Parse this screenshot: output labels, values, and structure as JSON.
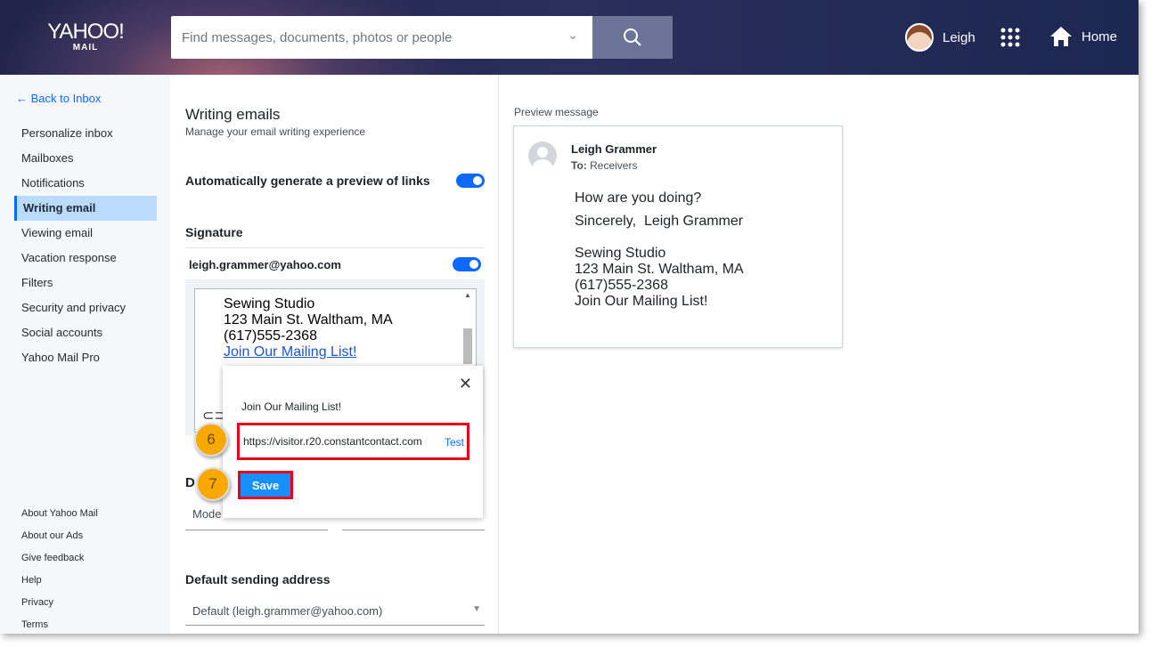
{
  "header": {
    "logo_top": "YAHOO!",
    "logo_bottom": "MAIL",
    "search_placeholder": "Find messages, documents, photos or people",
    "user": "Leigh",
    "home": "Home"
  },
  "sidebar": {
    "back": "Back to Inbox",
    "items": [
      "Personalize inbox",
      "Mailboxes",
      "Notifications",
      "Writing email",
      "Viewing email",
      "Vacation response",
      "Filters",
      "Security and privacy",
      "Social accounts",
      "Yahoo Mail Pro"
    ],
    "footer": [
      "About Yahoo Mail",
      "About our Ads",
      "Give feedback",
      "Help",
      "Privacy",
      "Terms"
    ]
  },
  "main": {
    "title": "Writing emails",
    "subtitle": "Manage your email writing experience",
    "link_preview": "Automatically generate a preview of links",
    "signature": "Signature",
    "account": "leigh.grammer@yahoo.com",
    "sig_lines": [
      "Sewing Studio",
      "123 Main St. Waltham, MA",
      "(617)555-2368"
    ],
    "sig_link": "Join Our Mailing List!",
    "section_d": "D",
    "mode": "Mode",
    "default_sending": "Default sending address",
    "default_value": "Default (leigh.grammer@yahoo.com)"
  },
  "popup": {
    "text": "Join Our Mailing List!",
    "url": "https://visitor.r20.constantcontact.com",
    "test": "Test",
    "save": "Save",
    "step6": "6",
    "step7": "7"
  },
  "preview": {
    "label": "Preview message",
    "from": "Leigh Grammer",
    "to_label": "To:",
    "to": "Receivers",
    "body1": "How are you doing?",
    "body2": "Sincerely,  Leigh Grammer",
    "lines": [
      "Sewing Studio",
      "123 Main St. Waltham, MA",
      "(617)555-2368",
      "Join Our Mailing List!"
    ]
  }
}
